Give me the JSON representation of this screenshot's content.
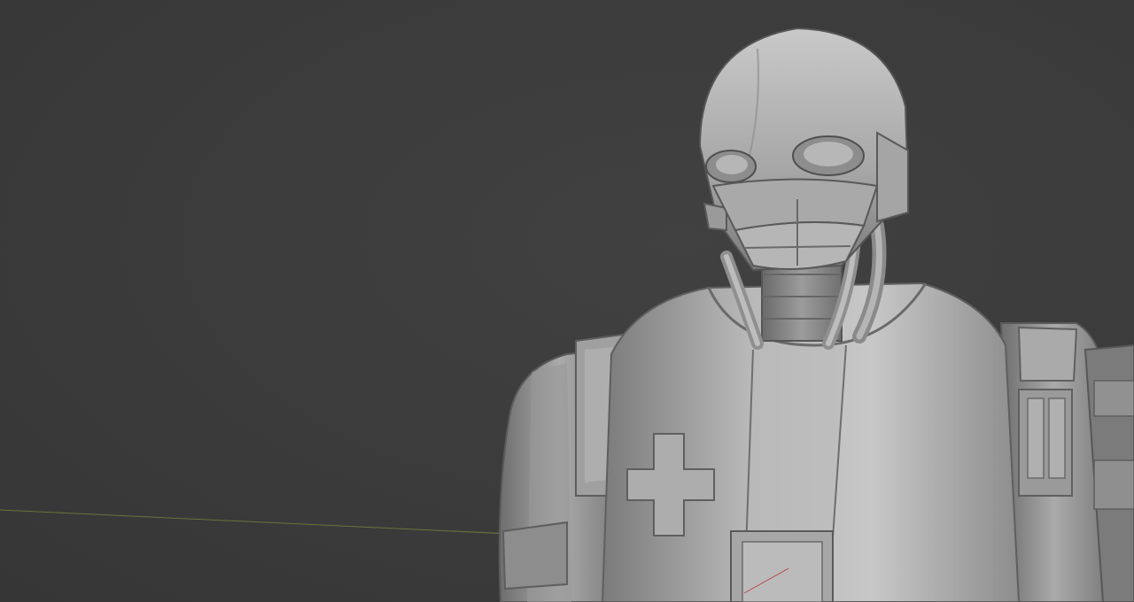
{
  "app": {
    "view": "3D viewport",
    "object": "robot-model"
  },
  "colors": {
    "background": "#3a3a3a",
    "model_light": "#d0d0d0",
    "model_mid": "#9b9b9b",
    "model_dark": "#5f5f5f",
    "x_axis_line": "#8a9a3a",
    "accent_red": "#b84a4a"
  }
}
